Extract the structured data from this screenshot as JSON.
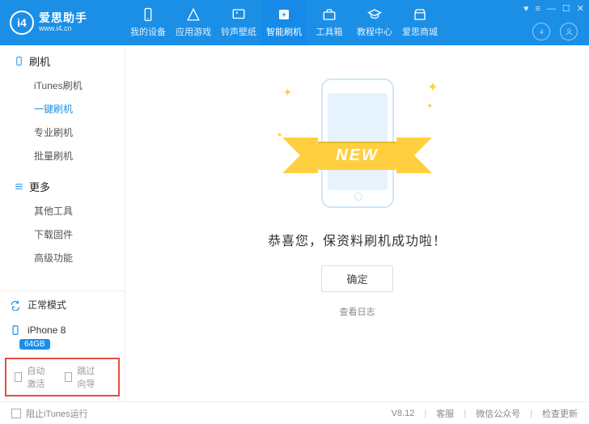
{
  "brand": {
    "name": "爱思助手",
    "url": "www.i4.cn"
  },
  "nav": [
    {
      "label": "我的设备"
    },
    {
      "label": "应用游戏"
    },
    {
      "label": "铃声壁纸"
    },
    {
      "label": "智能刷机"
    },
    {
      "label": "工具箱"
    },
    {
      "label": "教程中心"
    },
    {
      "label": "爱思商城"
    }
  ],
  "active_nav": 3,
  "sidebar": {
    "sect1": {
      "title": "刷机",
      "items": [
        "iTunes刷机",
        "一键刷机",
        "专业刷机",
        "批量刷机"
      ],
      "active": 1
    },
    "sect2": {
      "title": "更多",
      "items": [
        "其他工具",
        "下载固件",
        "高级功能"
      ]
    }
  },
  "device": {
    "mode": "正常模式",
    "model": "iPhone 8",
    "storage": "64GB"
  },
  "options": {
    "auto_activate": "自动激活",
    "skip_wizard": "跳过向导"
  },
  "content": {
    "ribbon": "NEW",
    "success": "恭喜您，保资料刷机成功啦！",
    "ok": "确定",
    "view_log": "查看日志"
  },
  "footer": {
    "block_itunes": "阻止iTunes运行",
    "version": "V8.12",
    "support": "客服",
    "wechat": "微信公众号",
    "update": "检查更新"
  }
}
